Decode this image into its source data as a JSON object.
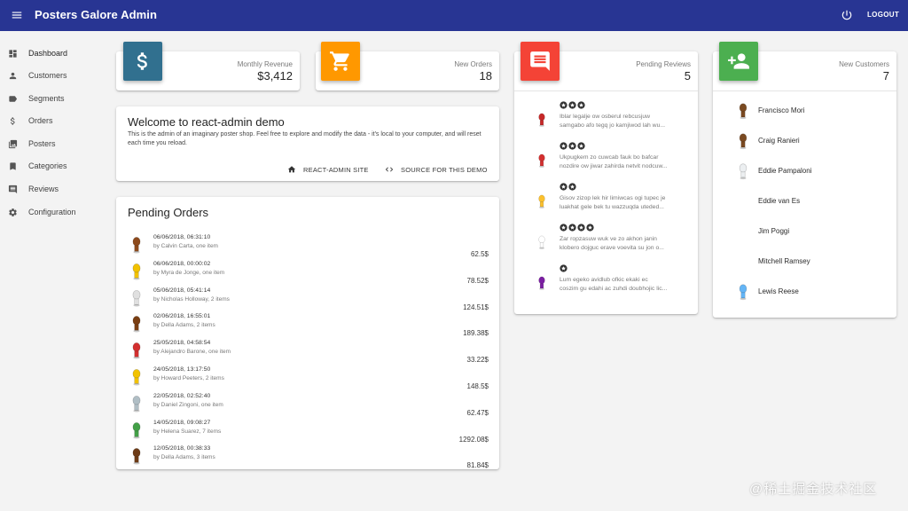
{
  "appbar": {
    "title": "Posters Galore Admin",
    "logout_label": "LOGOUT"
  },
  "sidebar": {
    "items": [
      {
        "label": "Dashboard",
        "icon": "dashboard-icon"
      },
      {
        "label": "Customers",
        "icon": "person-icon"
      },
      {
        "label": "Segments",
        "icon": "label-icon"
      },
      {
        "label": "Orders",
        "icon": "dollar-icon"
      },
      {
        "label": "Posters",
        "icon": "collections-icon"
      },
      {
        "label": "Categories",
        "icon": "bookmark-icon"
      },
      {
        "label": "Reviews",
        "icon": "comment-icon"
      },
      {
        "label": "Configuration",
        "icon": "settings-icon"
      }
    ]
  },
  "stats": {
    "revenue": {
      "label": "Monthly Revenue",
      "value": "$3,412",
      "color": "#31708f"
    },
    "orders": {
      "label": "New Orders",
      "value": "18",
      "color": "#ff9800"
    },
    "reviews": {
      "label": "Pending Reviews",
      "value": "5",
      "color": "#f44336"
    },
    "customers": {
      "label": "New Customers",
      "value": "7",
      "color": "#4caf50"
    }
  },
  "welcome": {
    "title": "Welcome to react-admin demo",
    "text": "This is the admin of an imaginary poster shop. Feel free to explore and modify the data - it's local to your computer, and will reset each time you reload.",
    "link1": "REACT-ADMIN SITE",
    "link2": "SOURCE FOR THIS DEMO"
  },
  "pending_orders": {
    "title": "Pending Orders",
    "orders": [
      {
        "date": "06/06/2018, 06:31:10",
        "by": "by Calvin Carta, one item",
        "amount": "62.5$"
      },
      {
        "date": "06/06/2018, 00:00:02",
        "by": "by Myra de Jonge, one item",
        "amount": "78.52$"
      },
      {
        "date": "05/06/2018, 05:41:14",
        "by": "by Nicholas Holloway, 2 items",
        "amount": "124.51$"
      },
      {
        "date": "02/06/2018, 16:55:01",
        "by": "by Della Adams, 2 items",
        "amount": "189.38$"
      },
      {
        "date": "25/05/2018, 04:58:54",
        "by": "by Alejandro Barone, one item",
        "amount": "33.22$"
      },
      {
        "date": "24/05/2018, 13:17:50",
        "by": "by Howard Peeters, 2 items",
        "amount": "148.5$"
      },
      {
        "date": "22/05/2018, 02:52:40",
        "by": "by Daniel Zingoni, one item",
        "amount": "62.47$"
      },
      {
        "date": "14/05/2018, 09:08:27",
        "by": "by Helena Suarez, 7 items",
        "amount": "1292.08$"
      },
      {
        "date": "12/05/2018, 00:38:33",
        "by": "by Della Adams, 3 items",
        "amount": "81.84$"
      }
    ]
  },
  "reviews": [
    {
      "stars": 3,
      "line1": "Iblar legalje ow osberul rebcusjuw",
      "line2": "samgabo afo tegq jo kamjiwod lah wu...",
      "avatar_color": "#c62828"
    },
    {
      "stars": 3,
      "line1": "Ukpugkem zo cuwcab fauk bo bafcar",
      "line2": "nozdire ow jiwar zahirda netvit nodcuw...",
      "avatar_color": "#d32f2f"
    },
    {
      "stars": 2,
      "line1": "Gisov zizop lek hir limiwcas ogi tupec je",
      "line2": "luakhat gele bek tu wazzuqda uteded...",
      "avatar_color": "#fbc02d"
    },
    {
      "stars": 4,
      "line1": "Zar ropzasuw wuk ve zo akhon janin",
      "line2": "klobero dojguc erave voevita su jon o...",
      "avatar_color": "#ffffff"
    },
    {
      "stars": 1,
      "line1": "Lum egeko avidlub ofkic ekaki ec",
      "line2": "coszim gu edahi ac zuhdi doubhojic lic...",
      "avatar_color": "#7b1fa2"
    }
  ],
  "customers": [
    {
      "name": "Francisco Mori",
      "avatar": "brown"
    },
    {
      "name": "Craig Ranieri",
      "avatar": "brown"
    },
    {
      "name": "Eddie Pampaloni",
      "avatar": "white"
    },
    {
      "name": "Eddie van Es",
      "avatar": "none"
    },
    {
      "name": "Jim Poggi",
      "avatar": "none"
    },
    {
      "name": "Mitchell Ramsey",
      "avatar": "none"
    },
    {
      "name": "Lewis Reese",
      "avatar": "blue"
    }
  ],
  "watermark": "@稀土掘金技术社区"
}
